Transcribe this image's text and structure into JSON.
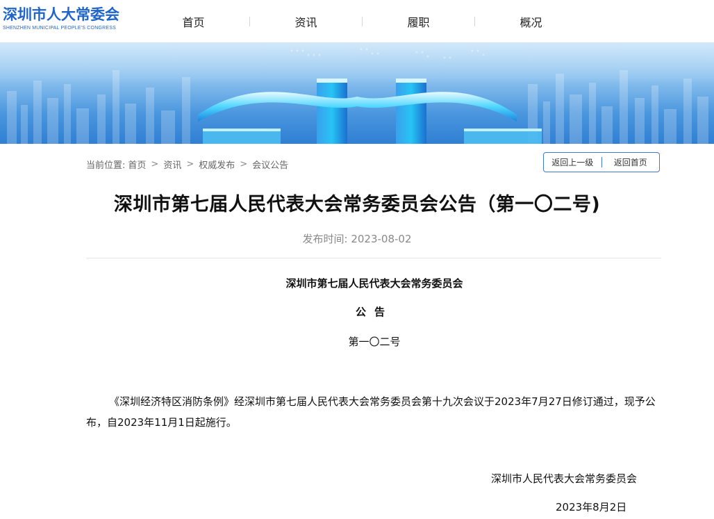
{
  "header": {
    "logo_cn": "深圳市人大常委会",
    "logo_en": "SHENZHEN MUNICIPAL PEOPLE'S CONGRESS",
    "nav": [
      {
        "label": "首页"
      },
      {
        "label": "资讯"
      },
      {
        "label": "履职"
      },
      {
        "label": "概况"
      }
    ]
  },
  "breadcrumb": {
    "prefix": "当前位置:",
    "items": [
      "首页",
      "资讯",
      "权威发布",
      "会议公告"
    ],
    "separator": ">"
  },
  "actions": {
    "back_up": "返回上一级",
    "back_home": "返回首页"
  },
  "article": {
    "title": "深圳市第七届人民代表大会常务委员会公告（第一〇二号)",
    "pub_time": "发布时间: 2023-08-02",
    "org_line": "深圳市第七届人民代表大会常务委员会",
    "notice_word": "公告",
    "number_line": "第一〇二号",
    "body": "《深圳经济特区消防条例》经深圳市第七届人民代表大会常务委员会第十九次会议于2023年7月27日修订通过，现予公布，自2023年11月1日起施行。",
    "sign_org": "深圳市人民代表大会常务委员会",
    "sign_date": "2023年8月2日"
  },
  "colors": {
    "brand_blue": "#1f64c8",
    "button_border": "#3f78d1"
  }
}
